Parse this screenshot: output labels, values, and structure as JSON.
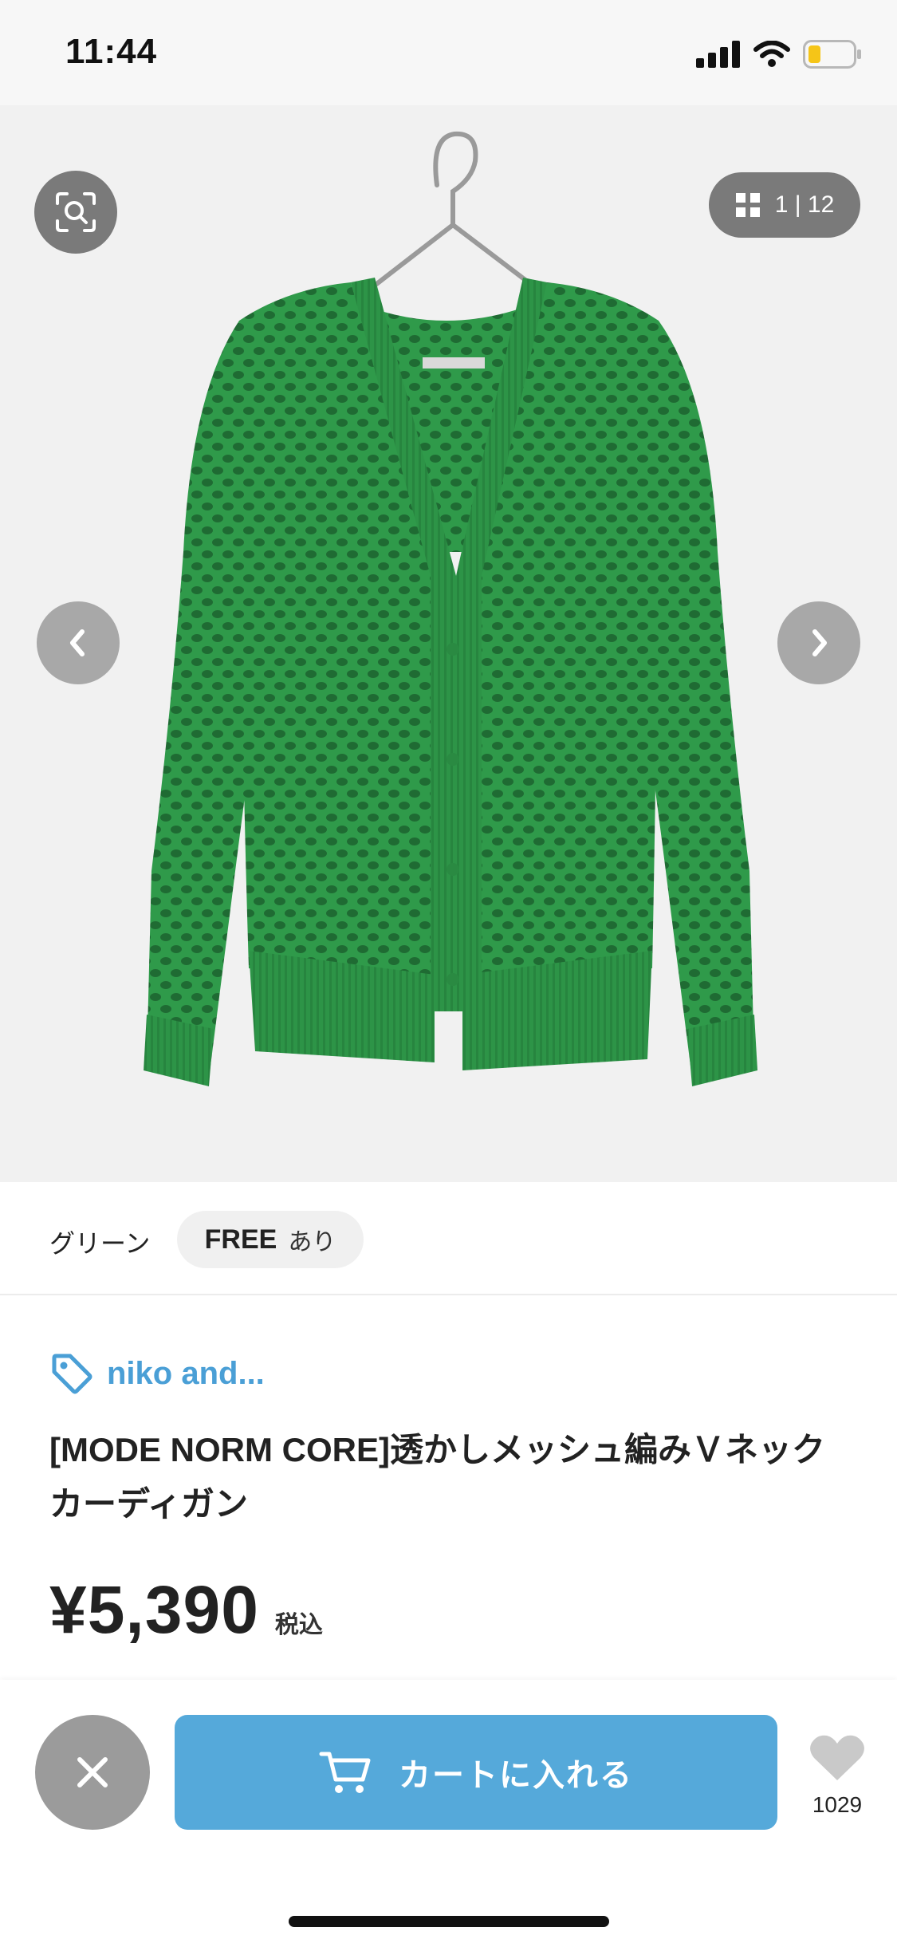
{
  "status_bar": {
    "time": "11:44"
  },
  "gallery": {
    "counter": "1 | 12",
    "image_alt": "green open-mesh V-neck cardigan on hanger"
  },
  "variant": {
    "color": "グリーン",
    "size": "FREE",
    "stock": "あり"
  },
  "product": {
    "brand": "niko and...",
    "title": "[MODE NORM CORE]透かしメッシュ編みＶネックカーディガン",
    "price": "¥5,390",
    "tax_note": "税込"
  },
  "actions": {
    "cart_label": "カートに入れる",
    "like_count": "1029"
  },
  "colors": {
    "accent": "#55a9da",
    "brand_text": "#4a9fd6",
    "garment": "#2f9a4a"
  }
}
